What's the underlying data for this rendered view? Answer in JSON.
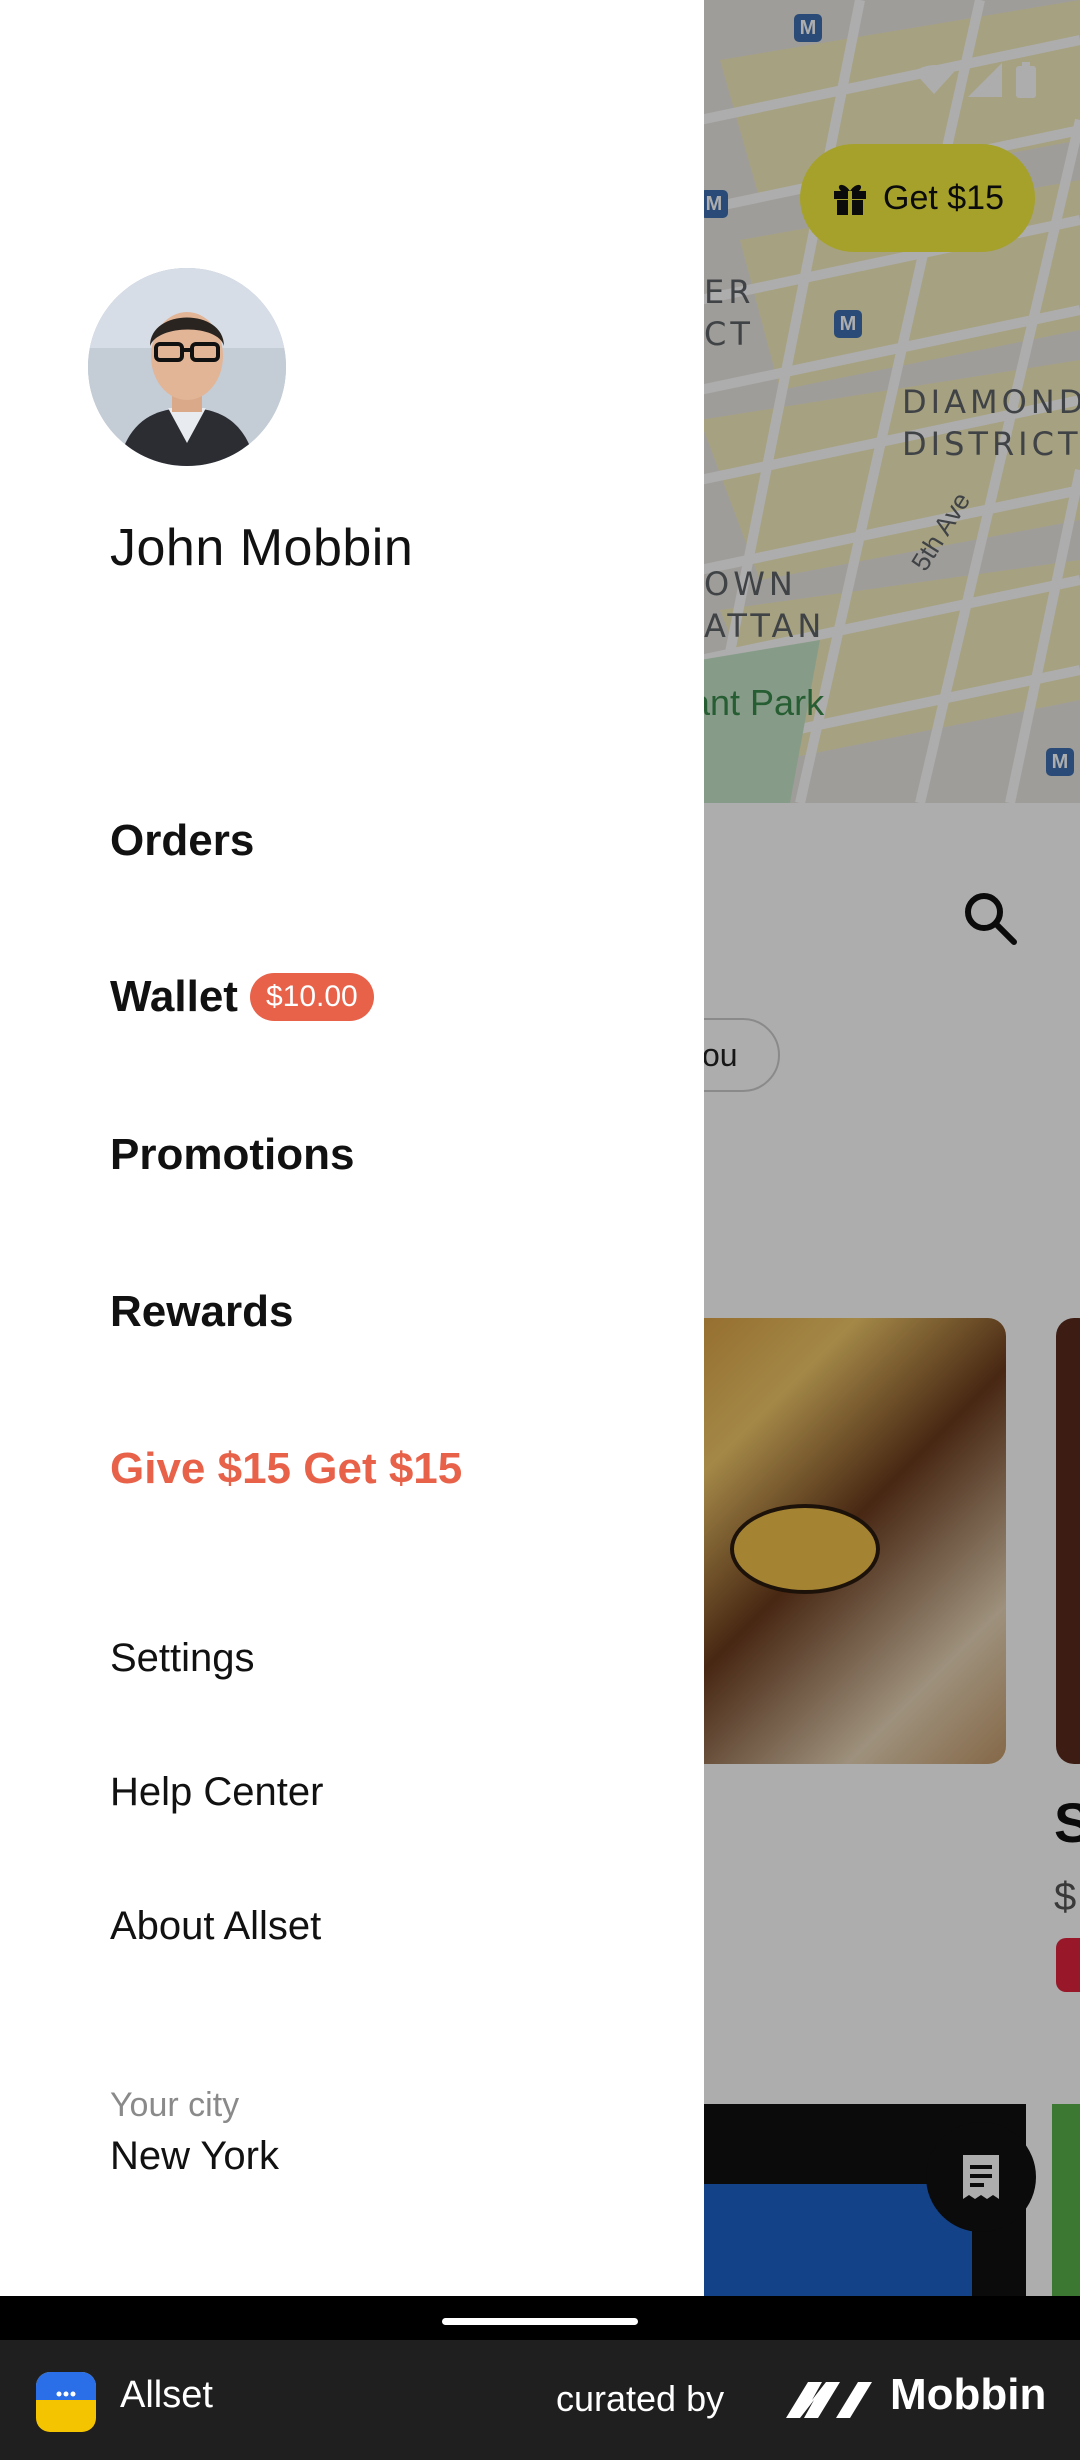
{
  "map": {
    "labels": {
      "district_line1": "ER",
      "district_line2": "CT",
      "diamond_line1": "DIAMOND",
      "diamond_line2": "DISTRICT",
      "midtown_line1": "OWN",
      "midtown_line2": "ATTAN",
      "park": "ant Park",
      "street": "5th Ave"
    },
    "metro_glyph": "M"
  },
  "promo_chip": {
    "label": "Get $15",
    "icon": "gift-icon",
    "color": "#f3ee3f"
  },
  "background": {
    "pill_text": "ou",
    "card_title_fragment": "S",
    "card_price_fragment": "$"
  },
  "drawer": {
    "user": {
      "name": "John Mobbin"
    },
    "menu": {
      "orders": "Orders",
      "wallet": "Wallet",
      "wallet_balance": "$10.00",
      "promotions": "Promotions",
      "rewards": "Rewards",
      "referral": "Give $15 Get $15",
      "settings": "Settings",
      "help": "Help Center",
      "about": "About Allset"
    },
    "city": {
      "caption": "Your city",
      "value": "New York"
    }
  },
  "footer": {
    "app_name": "Allset",
    "curated_by": "curated by",
    "brand": "Mobbin"
  },
  "colors": {
    "accent": "#e8624a",
    "promo_chip": "#f3ee3f",
    "scrim": "rgba(0,0,0,0.32)"
  }
}
